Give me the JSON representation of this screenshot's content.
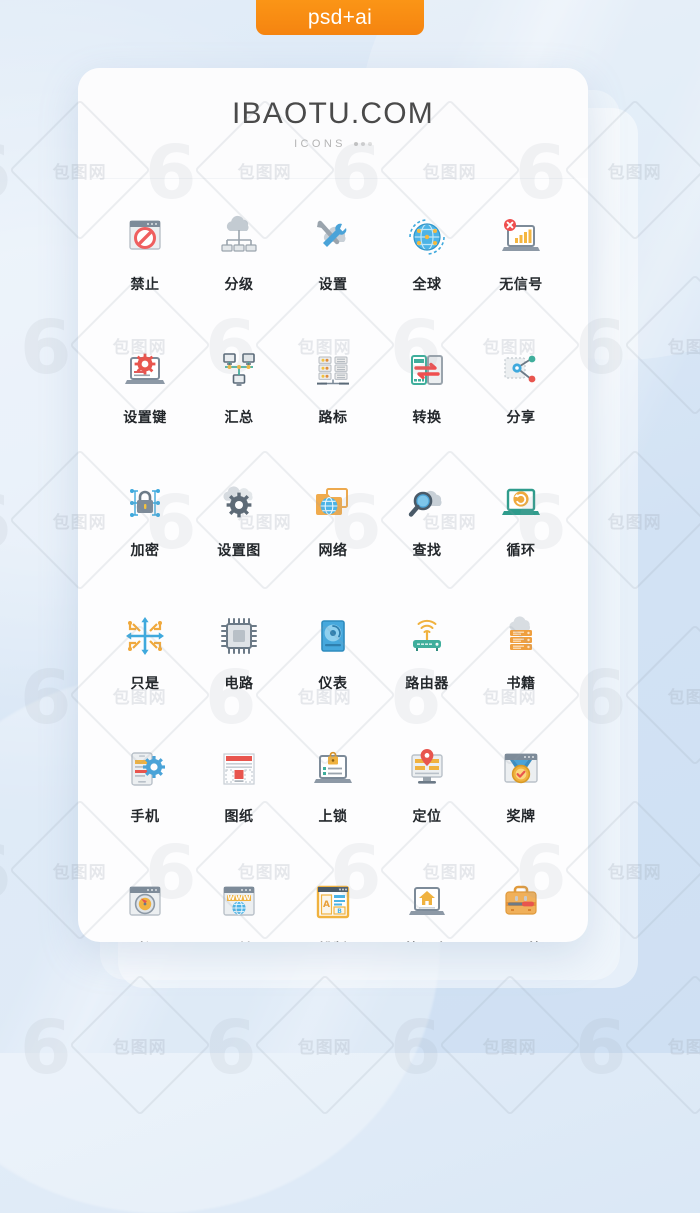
{
  "badge": {
    "label": "psd+ai"
  },
  "card": {
    "brand": "IBAOTU.COM",
    "subtitle": "ICONS"
  },
  "colors": {
    "badge_orange": "#f7900f",
    "background_blue": "#d6e5f4",
    "card_white": "#fdfdfe",
    "label_dark": "#23272b",
    "brand_gray": "#4a4a4a",
    "sub_gray": "#b4b4b4",
    "accent_orange": "#f0a43c",
    "accent_blue": "#46a8dd",
    "accent_teal": "#3fae9c",
    "accent_red": "#ea5a5a",
    "accent_slate": "#6c7a87"
  },
  "watermark": {
    "text": "包图网"
  },
  "grid": {
    "columns": 5,
    "icons": [
      {
        "label": "禁止",
        "icon": "browser-prohibited-icon"
      },
      {
        "label": "分级",
        "icon": "cloud-hierarchy-icon"
      },
      {
        "label": "设置",
        "icon": "cloud-tools-icon"
      },
      {
        "label": "全球",
        "icon": "global-network-icon"
      },
      {
        "label": "无信号",
        "icon": "laptop-no-signal-icon"
      },
      {
        "label": "设置键",
        "icon": "laptop-settings-icon"
      },
      {
        "label": "汇总",
        "icon": "computers-network-icon"
      },
      {
        "label": "路标",
        "icon": "server-rack-icon"
      },
      {
        "label": "转换",
        "icon": "phone-transfer-icon"
      },
      {
        "label": "分享",
        "icon": "share-nodes-icon"
      },
      {
        "label": "加密",
        "icon": "lock-encryption-icon"
      },
      {
        "label": "设置图",
        "icon": "cloud-gear-icon"
      },
      {
        "label": "网络",
        "icon": "folder-globe-icon"
      },
      {
        "label": "查找",
        "icon": "cloud-search-icon"
      },
      {
        "label": "循环",
        "icon": "laptop-loop-icon"
      },
      {
        "label": "只是",
        "icon": "arrows-cross-icon"
      },
      {
        "label": "电路",
        "icon": "cpu-chip-icon"
      },
      {
        "label": "仪表",
        "icon": "hard-disk-icon"
      },
      {
        "label": "路由器",
        "icon": "router-wifi-icon"
      },
      {
        "label": "书籍",
        "icon": "cloud-server-stack-icon"
      },
      {
        "label": "手机",
        "icon": "mobile-settings-icon"
      },
      {
        "label": "图纸",
        "icon": "blueprint-layout-icon"
      },
      {
        "label": "上锁",
        "icon": "laptop-lock-icon"
      },
      {
        "label": "定位",
        "icon": "monitor-location-icon"
      },
      {
        "label": "奖牌",
        "icon": "browser-medal-icon"
      },
      {
        "label": "时间",
        "icon": "browser-clock-icon"
      },
      {
        "label": "网址",
        "icon": "browser-www-icon"
      },
      {
        "label": "排版",
        "icon": "layout-typography-icon"
      },
      {
        "label": "笔记本",
        "icon": "laptop-home-icon"
      },
      {
        "label": "工具箱",
        "icon": "toolbox-icon"
      }
    ]
  }
}
